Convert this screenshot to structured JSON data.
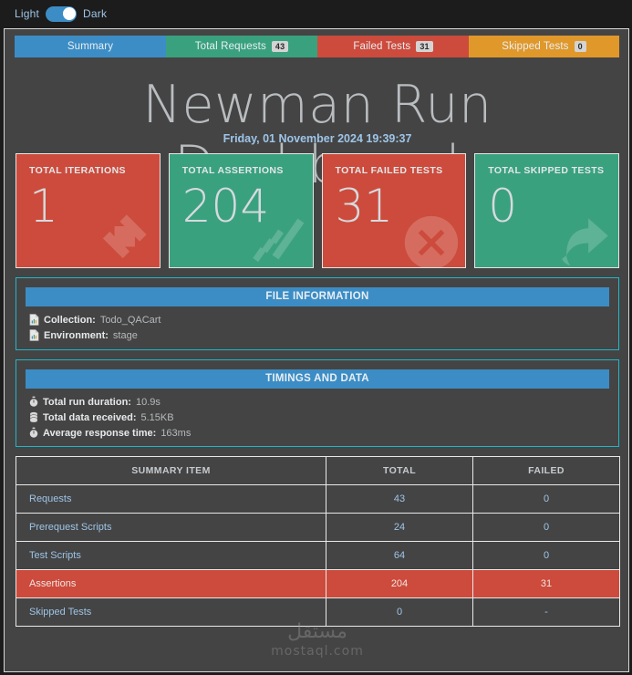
{
  "theme_toggle": {
    "light_label": "Light",
    "dark_label": "Dark",
    "active": "Dark"
  },
  "tabs": [
    {
      "label": "Summary",
      "badge": "",
      "color": "#3c8dc5"
    },
    {
      "label": "Total Requests",
      "badge": "43",
      "color": "#3aa17e"
    },
    {
      "label": "Failed Tests",
      "badge": "31",
      "color": "#cc4b3c"
    },
    {
      "label": "Skipped Tests",
      "badge": "0",
      "color": "#e0982a"
    }
  ],
  "header": {
    "title": "Newman Run Dashboard",
    "timestamp": "Friday, 01 November 2024 19:39:37"
  },
  "cards": [
    {
      "label": "TOTAL ITERATIONS",
      "value": "1",
      "color": "#cc4b3c",
      "icon": "arrows-expand-icon"
    },
    {
      "label": "TOTAL ASSERTIONS",
      "value": "204",
      "color": "#3aa17e",
      "icon": "check-lines-icon"
    },
    {
      "label": "TOTAL FAILED TESTS",
      "value": "31",
      "color": "#cc4b3c",
      "icon": "times-circle-icon"
    },
    {
      "label": "TOTAL SKIPPED TESTS",
      "value": "0",
      "color": "#3aa17e",
      "icon": "share-arrow-icon"
    }
  ],
  "file_information": {
    "heading": "FILE INFORMATION",
    "rows": [
      {
        "icon": "file-icon",
        "key": "Collection:",
        "value": "Todo_QACart"
      },
      {
        "icon": "file-icon",
        "key": "Environment:",
        "value": "stage"
      }
    ]
  },
  "timings_and_data": {
    "heading": "TIMINGS AND DATA",
    "rows": [
      {
        "icon": "stopwatch-icon",
        "key": "Total run duration:",
        "value": "10.9s"
      },
      {
        "icon": "database-icon",
        "key": "Total data received:",
        "value": "5.15KB"
      },
      {
        "icon": "stopwatch-icon",
        "key": "Average response time:",
        "value": "163ms"
      }
    ]
  },
  "summary_table": {
    "columns": [
      "SUMMARY ITEM",
      "TOTAL",
      "FAILED"
    ],
    "rows": [
      {
        "item": "Requests",
        "total": "43",
        "failed": "0",
        "flagged": false
      },
      {
        "item": "Prerequest Scripts",
        "total": "24",
        "failed": "0",
        "flagged": false
      },
      {
        "item": "Test Scripts",
        "total": "64",
        "failed": "0",
        "flagged": false
      },
      {
        "item": "Assertions",
        "total": "204",
        "failed": "31",
        "flagged": true
      },
      {
        "item": "Skipped Tests",
        "total": "0",
        "failed": "-",
        "flagged": false
      }
    ]
  },
  "watermark": {
    "arabic": "مستقل",
    "latin": "mostaql.com"
  }
}
